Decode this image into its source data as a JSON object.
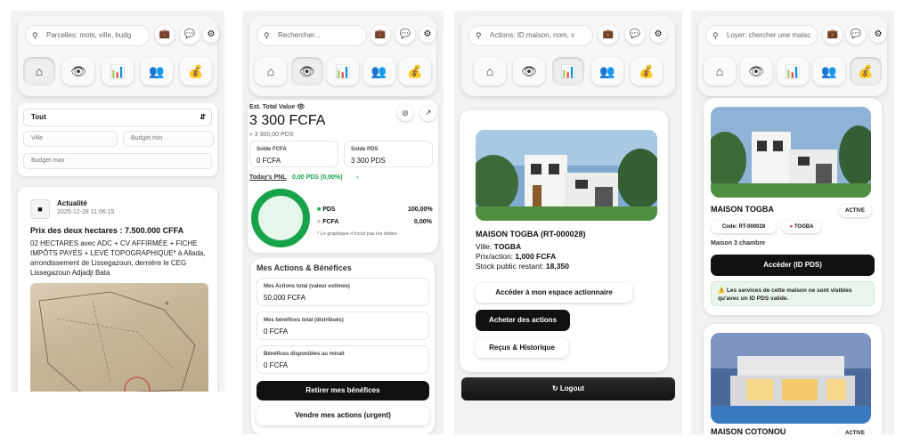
{
  "colors": {
    "accent_green": "#16a34a",
    "dark_button": "#111111",
    "background": "#f2f2f2"
  },
  "icons": {
    "search": "magnifier-icon",
    "briefcase": "briefcase-icon",
    "chat": "chat-bubble-icon",
    "settings": "gear-icon",
    "nav": [
      "house-icon",
      "eye-icon",
      "bar-chart-icon",
      "users-icon",
      "cash-hand-icon"
    ]
  },
  "screens": [
    {
      "search_placeholder": "Parcelles: mots, ville, budg",
      "active_nav": 0,
      "filter": {
        "select_value": "Tout",
        "ville_placeholder": "Ville",
        "budget_min_placeholder": "Budget min",
        "budget_max_placeholder": "Budget max"
      },
      "post": {
        "category": "Actualité",
        "date": "2025-12-28 11:06:15",
        "title": "Prix des deux hectares : 7.500.000 CFFA",
        "body": "02 HECTARES avec ADC + CV AFFIRMÉE + FICHE IMPÔTS PAYÉS + LEVÉ TOPOGRAPHIQUE* à Allada, arrondissement de Lissegazoun, dernière le CEG Lissegazoun Adjadji Bata"
      }
    },
    {
      "search_placeholder": "Rechercher...",
      "active_nav": 1,
      "wallet": {
        "total_label": "Est. Total Value",
        "total_value": "3 300 FCFA",
        "total_sub": "≈ 3 300,00 PDS",
        "solde_fcfa_label": "Solde FCFA",
        "solde_fcfa_value": "0 FCFA",
        "solde_pds_label": "Solde PDS",
        "solde_pds_value": "3 300 PDS",
        "pnl_label": "Today's PNL",
        "pnl_value": "0,00 PDS (0,00%)",
        "pnl_chevron": "›",
        "legend": [
          {
            "name": "PDS",
            "value": "100,00%",
            "color": "#16a34a"
          },
          {
            "name": "FCFA",
            "value": "0,00%",
            "color": "#c8c8c8"
          }
        ],
        "chart_note": "* Le graphique n'inclut pas les dettes."
      },
      "actions": {
        "title": "Mes Actions & Bénéfices",
        "fields": [
          {
            "label": "Mes Actions total (valeur estimée)",
            "value": "50,000 FCFA"
          },
          {
            "label": "Mes bénéfices total (distribués)",
            "value": "0 FCFA"
          },
          {
            "label": "Bénéfices disponibles au retrait",
            "value": "0 FCFA"
          }
        ],
        "withdraw_button": "Retirer mes bénéfices",
        "sell_button": "Vendre mes actions (urgent)"
      }
    },
    {
      "search_placeholder": "Actions: ID maison, nom, v",
      "active_nav": 2,
      "house": {
        "title": "MAISON TOGBA (RT-000028)",
        "ville_label": "Ville:",
        "ville": "TOGBA",
        "price_label": "Prix/action:",
        "price": "1,000 FCFA",
        "stock_label": "Stock public restant:",
        "stock": "18,350",
        "buttons": [
          "Accéder à mon espace actionnaire",
          "Acheter des actions",
          "Reçus & Historique"
        ]
      },
      "logout_label": "Logout"
    },
    {
      "search_placeholder": "Loyer: chercher une maisc",
      "active_nav": 4,
      "rental": {
        "name": "MAISON TOGBA",
        "status": "ACTIVE",
        "code_label": "Code:",
        "code": "RT-000028",
        "city": "TOGBA",
        "desc": "Maison 3 chambre",
        "access_button": "Accéder (ID PDS)",
        "warning": "⚠️ Les services de cette maison ne sont visibles qu'avec un ID PDS valide."
      },
      "rental2": {
        "name": "MAISON COTONOU",
        "status": "ACTIVE"
      }
    }
  ]
}
